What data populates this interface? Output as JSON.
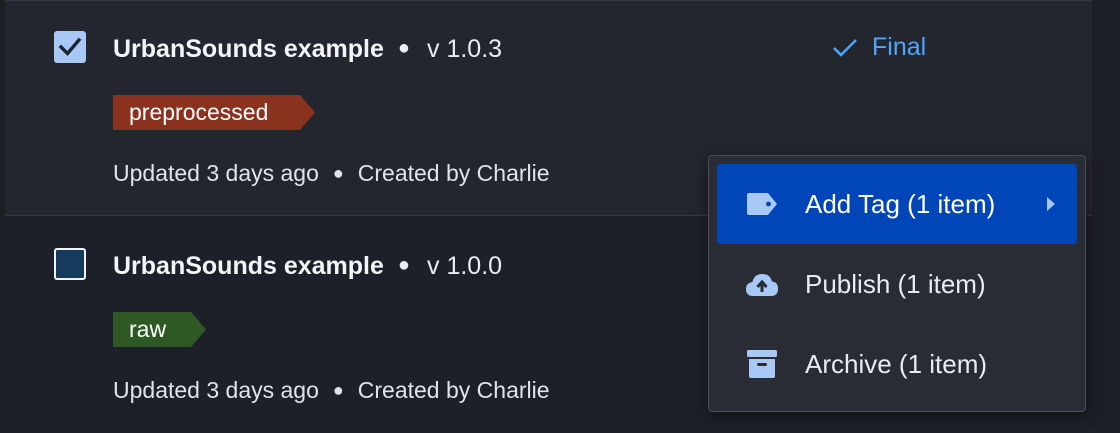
{
  "items": [
    {
      "title": "UrbanSounds example",
      "separator": "●",
      "version": "v 1.0.3",
      "tag": "preprocessed",
      "updated": "Updated 3 days ago",
      "meta_separator": "●",
      "created": "Created by Charlie",
      "checked": true,
      "status": "Final"
    },
    {
      "title": "UrbanSounds example",
      "separator": "●",
      "version": "v 1.0.0",
      "tag": "raw",
      "updated": "Updated 3 days ago",
      "meta_separator": "●",
      "created": "Created by Charlie",
      "checked": false
    }
  ],
  "context_menu": {
    "items": [
      {
        "label": "Add Tag (1 item)",
        "icon": "tag-icon",
        "has_submenu": true,
        "active": true
      },
      {
        "label": "Publish (1 item)",
        "icon": "cloud-upload-icon",
        "has_submenu": false,
        "active": false
      },
      {
        "label": "Archive (1 item)",
        "icon": "archive-icon",
        "has_submenu": false,
        "active": false
      }
    ]
  },
  "colors": {
    "page_background": "#1c1f26",
    "selected_row": "#23262f",
    "tag_preprocessed": "#8b321f",
    "tag_raw": "#2f5924",
    "status_blue": "#4ea6ff",
    "menu_active": "#0046b8",
    "icon_blue": "#a8c8f5"
  }
}
